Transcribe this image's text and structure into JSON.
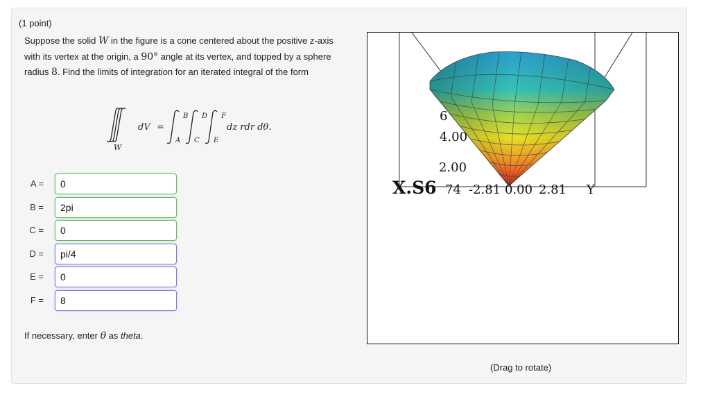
{
  "problem": {
    "points": "(1 point)",
    "text_1": "Suppose the solid ",
    "solid_var": "W",
    "text_2": " in the figure is a cone centered about the positive z-axis with its vertex at the origin, a ",
    "angle": "90°",
    "text_3": " angle at its vertex, and topped by a sphere radius ",
    "radius": "8",
    "text_4": ". Find the limits of integration for an iterated integral of the form",
    "formula": {
      "region": "W",
      "lhs_integrand": "dV",
      "equals": "=",
      "upper_B": "B",
      "lower_A": "A",
      "upper_D": "D",
      "lower_C": "C",
      "upper_F": "F",
      "lower_E": "E",
      "rhs_integrand": "dz rdr dθ."
    }
  },
  "answers": [
    {
      "label": "A =",
      "value": "0",
      "status": "correct"
    },
    {
      "label": "B =",
      "value": "2pi",
      "status": "correct"
    },
    {
      "label": "C =",
      "value": "0",
      "status": "correct"
    },
    {
      "label": "D =",
      "value": "pi/4",
      "status": "neutral"
    },
    {
      "label": "E =",
      "value": "0",
      "status": "neutral"
    },
    {
      "label": "F =",
      "value": "8",
      "status": "neutral"
    }
  ],
  "hint": {
    "text_1": "If necessary, enter ",
    "symbol": "θ",
    "text_2": " as ",
    "keyword": "theta",
    "text_3": "."
  },
  "viewer": {
    "label_z_partial": "6",
    "tick_z_1": "4.00",
    "tick_z_2": "2.00",
    "axis_x_overlap": "X.S6",
    "tick_x_1": "74",
    "tick_y_1": "-2.81",
    "tick_y_2": "0.00",
    "tick_y_3": "2.81",
    "axis_y": "Y",
    "caption": "(Drag to rotate)"
  }
}
